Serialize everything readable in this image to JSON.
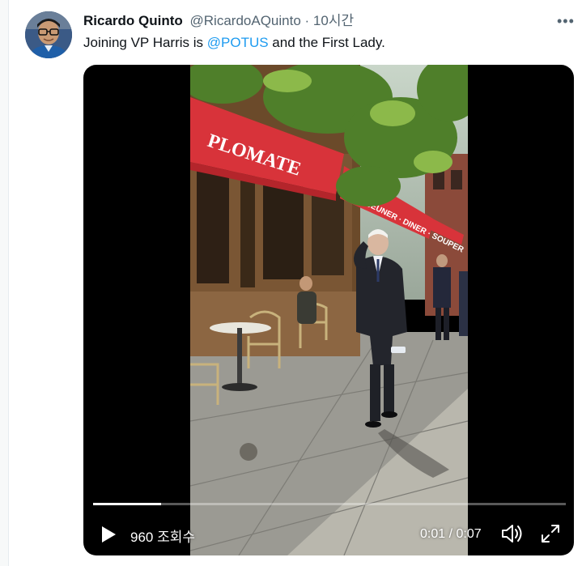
{
  "tweet": {
    "author_name": "Ricardo Quinto",
    "author_handle": "@RicardoAQuinto",
    "separator": "·",
    "time_ago": "10시간",
    "more_icon": "more-dots-icon",
    "text_before": "Joining VP Harris is ",
    "mention": "@POTUS",
    "text_after": " and the First Lady."
  },
  "video": {
    "sign_awning": "PLOMATE",
    "sign_lower": "DÉJEUNER · DINER · SOUPER",
    "view_count": "960 조회수",
    "current_time": "0:01",
    "time_separator": " / ",
    "duration": "0:07",
    "progress": 0.143,
    "icons": {
      "play": "play-icon",
      "volume": "volume-icon",
      "fullscreen": "fullscreen-icon"
    }
  },
  "colors": {
    "link": "#1d9bf0",
    "awning": "#d8333a",
    "text_primary": "#0f1419",
    "text_secondary": "#536471"
  }
}
